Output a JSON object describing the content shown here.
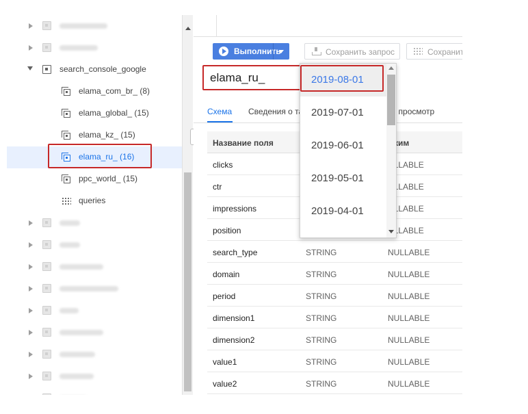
{
  "tree": {
    "dataset": {
      "name": "search_console_google",
      "icon": "dataset-icon"
    },
    "tables": [
      {
        "label": "elama_com_br_ (8)",
        "icon": "table-sharded-icon"
      },
      {
        "label": "elama_global_ (15)",
        "icon": "table-sharded-icon"
      },
      {
        "label": "elama_kz_ (15)",
        "icon": "table-sharded-icon"
      },
      {
        "label": "elama_ru_ (16)",
        "icon": "table-sharded-icon",
        "selected": true
      },
      {
        "label": "ppc_world_ (15)",
        "icon": "table-sharded-icon"
      },
      {
        "label": "queries",
        "icon": "view-icon"
      }
    ]
  },
  "toolbar": {
    "run_label": "Выполнить",
    "save_query_label": "Сохранить запрос",
    "save_view_label": "Сохранит"
  },
  "table": {
    "title": "elama_ru_"
  },
  "tabs": {
    "schema": "Схема",
    "details": "Сведения о та",
    "preview": "ьный просмотр"
  },
  "schema": {
    "headers": {
      "name": "Название поля",
      "mode": "ежим"
    },
    "rows": [
      {
        "name": "clicks",
        "type": "",
        "mode": "ULLABLE"
      },
      {
        "name": "ctr",
        "type": "",
        "mode": "ULLABLE"
      },
      {
        "name": "impressions",
        "type": "",
        "mode": "ULLABLE"
      },
      {
        "name": "position",
        "type": "",
        "mode": "ULLABLE"
      },
      {
        "name": "search_type",
        "type": "STRING",
        "mode": "NULLABLE"
      },
      {
        "name": "domain",
        "type": "STRING",
        "mode": "NULLABLE"
      },
      {
        "name": "period",
        "type": "STRING",
        "mode": "NULLABLE"
      },
      {
        "name": "dimension1",
        "type": "STRING",
        "mode": "NULLABLE"
      },
      {
        "name": "dimension2",
        "type": "STRING",
        "mode": "NULLABLE"
      },
      {
        "name": "value1",
        "type": "STRING",
        "mode": "NULLABLE"
      },
      {
        "name": "value2",
        "type": "STRING",
        "mode": "NULLABLE"
      }
    ]
  },
  "dropdown": {
    "options": [
      "2019-08-01",
      "2019-07-01",
      "2019-06-01",
      "2019-05-01",
      "2019-04-01"
    ],
    "selected": "2019-08-01"
  },
  "colors": {
    "accent": "#1a73e8",
    "run_button": "#4a7fe0",
    "highlight_box": "#c62828"
  }
}
